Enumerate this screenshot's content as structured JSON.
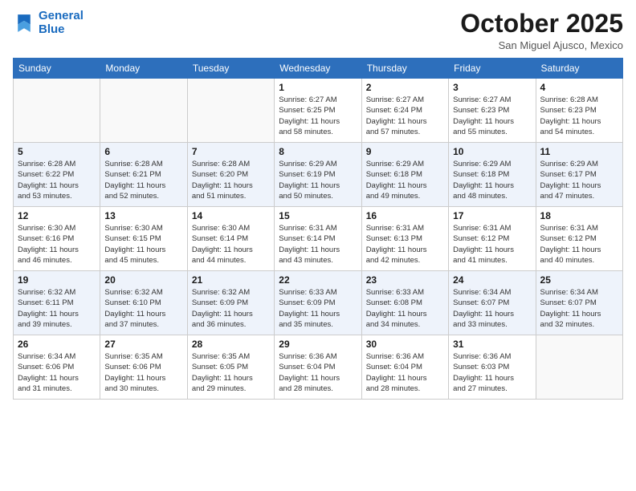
{
  "logo": {
    "line1": "General",
    "line2": "Blue"
  },
  "title": "October 2025",
  "location": "San Miguel Ajusco, Mexico",
  "days_of_week": [
    "Sunday",
    "Monday",
    "Tuesday",
    "Wednesday",
    "Thursday",
    "Friday",
    "Saturday"
  ],
  "weeks": [
    [
      {
        "day": "",
        "info": ""
      },
      {
        "day": "",
        "info": ""
      },
      {
        "day": "",
        "info": ""
      },
      {
        "day": "1",
        "info": "Sunrise: 6:27 AM\nSunset: 6:25 PM\nDaylight: 11 hours\nand 58 minutes."
      },
      {
        "day": "2",
        "info": "Sunrise: 6:27 AM\nSunset: 6:24 PM\nDaylight: 11 hours\nand 57 minutes."
      },
      {
        "day": "3",
        "info": "Sunrise: 6:27 AM\nSunset: 6:23 PM\nDaylight: 11 hours\nand 55 minutes."
      },
      {
        "day": "4",
        "info": "Sunrise: 6:28 AM\nSunset: 6:23 PM\nDaylight: 11 hours\nand 54 minutes."
      }
    ],
    [
      {
        "day": "5",
        "info": "Sunrise: 6:28 AM\nSunset: 6:22 PM\nDaylight: 11 hours\nand 53 minutes."
      },
      {
        "day": "6",
        "info": "Sunrise: 6:28 AM\nSunset: 6:21 PM\nDaylight: 11 hours\nand 52 minutes."
      },
      {
        "day": "7",
        "info": "Sunrise: 6:28 AM\nSunset: 6:20 PM\nDaylight: 11 hours\nand 51 minutes."
      },
      {
        "day": "8",
        "info": "Sunrise: 6:29 AM\nSunset: 6:19 PM\nDaylight: 11 hours\nand 50 minutes."
      },
      {
        "day": "9",
        "info": "Sunrise: 6:29 AM\nSunset: 6:18 PM\nDaylight: 11 hours\nand 49 minutes."
      },
      {
        "day": "10",
        "info": "Sunrise: 6:29 AM\nSunset: 6:18 PM\nDaylight: 11 hours\nand 48 minutes."
      },
      {
        "day": "11",
        "info": "Sunrise: 6:29 AM\nSunset: 6:17 PM\nDaylight: 11 hours\nand 47 minutes."
      }
    ],
    [
      {
        "day": "12",
        "info": "Sunrise: 6:30 AM\nSunset: 6:16 PM\nDaylight: 11 hours\nand 46 minutes."
      },
      {
        "day": "13",
        "info": "Sunrise: 6:30 AM\nSunset: 6:15 PM\nDaylight: 11 hours\nand 45 minutes."
      },
      {
        "day": "14",
        "info": "Sunrise: 6:30 AM\nSunset: 6:14 PM\nDaylight: 11 hours\nand 44 minutes."
      },
      {
        "day": "15",
        "info": "Sunrise: 6:31 AM\nSunset: 6:14 PM\nDaylight: 11 hours\nand 43 minutes."
      },
      {
        "day": "16",
        "info": "Sunrise: 6:31 AM\nSunset: 6:13 PM\nDaylight: 11 hours\nand 42 minutes."
      },
      {
        "day": "17",
        "info": "Sunrise: 6:31 AM\nSunset: 6:12 PM\nDaylight: 11 hours\nand 41 minutes."
      },
      {
        "day": "18",
        "info": "Sunrise: 6:31 AM\nSunset: 6:12 PM\nDaylight: 11 hours\nand 40 minutes."
      }
    ],
    [
      {
        "day": "19",
        "info": "Sunrise: 6:32 AM\nSunset: 6:11 PM\nDaylight: 11 hours\nand 39 minutes."
      },
      {
        "day": "20",
        "info": "Sunrise: 6:32 AM\nSunset: 6:10 PM\nDaylight: 11 hours\nand 37 minutes."
      },
      {
        "day": "21",
        "info": "Sunrise: 6:32 AM\nSunset: 6:09 PM\nDaylight: 11 hours\nand 36 minutes."
      },
      {
        "day": "22",
        "info": "Sunrise: 6:33 AM\nSunset: 6:09 PM\nDaylight: 11 hours\nand 35 minutes."
      },
      {
        "day": "23",
        "info": "Sunrise: 6:33 AM\nSunset: 6:08 PM\nDaylight: 11 hours\nand 34 minutes."
      },
      {
        "day": "24",
        "info": "Sunrise: 6:34 AM\nSunset: 6:07 PM\nDaylight: 11 hours\nand 33 minutes."
      },
      {
        "day": "25",
        "info": "Sunrise: 6:34 AM\nSunset: 6:07 PM\nDaylight: 11 hours\nand 32 minutes."
      }
    ],
    [
      {
        "day": "26",
        "info": "Sunrise: 6:34 AM\nSunset: 6:06 PM\nDaylight: 11 hours\nand 31 minutes."
      },
      {
        "day": "27",
        "info": "Sunrise: 6:35 AM\nSunset: 6:06 PM\nDaylight: 11 hours\nand 30 minutes."
      },
      {
        "day": "28",
        "info": "Sunrise: 6:35 AM\nSunset: 6:05 PM\nDaylight: 11 hours\nand 29 minutes."
      },
      {
        "day": "29",
        "info": "Sunrise: 6:36 AM\nSunset: 6:04 PM\nDaylight: 11 hours\nand 28 minutes."
      },
      {
        "day": "30",
        "info": "Sunrise: 6:36 AM\nSunset: 6:04 PM\nDaylight: 11 hours\nand 28 minutes."
      },
      {
        "day": "31",
        "info": "Sunrise: 6:36 AM\nSunset: 6:03 PM\nDaylight: 11 hours\nand 27 minutes."
      },
      {
        "day": "",
        "info": ""
      }
    ]
  ]
}
